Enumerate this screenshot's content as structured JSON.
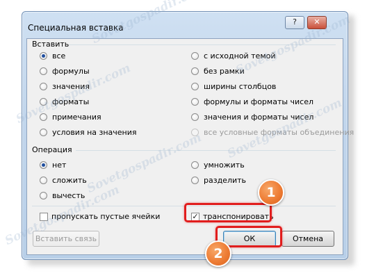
{
  "dialog": {
    "title": "Специальная вставка",
    "help_label": "?",
    "close_label": "✕"
  },
  "paste_group": {
    "label": "Вставить",
    "options_left": [
      {
        "label": "все",
        "checked": true
      },
      {
        "label": "формулы",
        "checked": false
      },
      {
        "label": "значения",
        "checked": false
      },
      {
        "label": "форматы",
        "checked": false
      },
      {
        "label": "примечания",
        "checked": false
      },
      {
        "label": "условия на значения",
        "checked": false
      }
    ],
    "options_right": [
      {
        "label": "с исходной темой",
        "checked": false
      },
      {
        "label": "без рамки",
        "checked": false
      },
      {
        "label": "ширины столбцов",
        "checked": false
      },
      {
        "label": "формулы и форматы чисел",
        "checked": false
      },
      {
        "label": "значения и форматы чисел",
        "checked": false
      },
      {
        "label": "все условные форматы объединения",
        "checked": false,
        "disabled": true
      }
    ]
  },
  "operation_group": {
    "label": "Операция",
    "options_left": [
      {
        "label": "нет",
        "checked": true
      },
      {
        "label": "сложить",
        "checked": false
      },
      {
        "label": "вычесть",
        "checked": false
      }
    ],
    "options_right": [
      {
        "label": "умножить",
        "checked": false
      },
      {
        "label": "разделить",
        "checked": false
      }
    ]
  },
  "checkboxes": {
    "skip_blanks": {
      "label": "пропускать пустые ячейки",
      "checked": false
    },
    "transpose": {
      "label": "транспонировать",
      "checked": true
    }
  },
  "buttons": {
    "paste_link": "Вставить связь",
    "ok": "ОК",
    "cancel": "Отмена"
  },
  "annotations": {
    "badge_1": "1",
    "badge_2": "2",
    "highlight_color": "#e11d1d",
    "badge_color": "#ee7d35"
  },
  "watermark": {
    "text": "Sovetgospadir.com"
  }
}
